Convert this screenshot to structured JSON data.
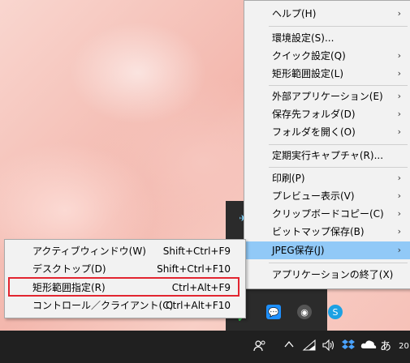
{
  "main_menu": {
    "items": [
      {
        "label": "ヘルプ(H)",
        "submenu": true
      },
      {
        "label": "環境設定(S)...",
        "submenu": false
      },
      {
        "label": "クイック設定(Q)",
        "submenu": true
      },
      {
        "label": "矩形範囲設定(L)",
        "submenu": true
      },
      {
        "label": "外部アプリケーション(E)",
        "submenu": true
      },
      {
        "label": "保存先フォルダ(D)",
        "submenu": true
      },
      {
        "label": "フォルダを開く(O)",
        "submenu": true
      },
      {
        "label": "定期実行キャプチャ(R)...",
        "submenu": false
      },
      {
        "label": "印刷(P)",
        "submenu": true
      },
      {
        "label": "プレビュー表示(V)",
        "submenu": true
      },
      {
        "label": "クリップボードコピー(C)",
        "submenu": true
      },
      {
        "label": "ビットマップ保存(B)",
        "submenu": true
      },
      {
        "label": "JPEG保存(J)",
        "submenu": true,
        "highlighted": true
      },
      {
        "label": "アプリケーションの終了(X)",
        "submenu": false
      }
    ],
    "arrow": "›"
  },
  "sub_menu": {
    "items": [
      {
        "label": "アクティブウィンドウ(W)",
        "shortcut": "Shift+Ctrl+F9"
      },
      {
        "label": "デスクトップ(D)",
        "shortcut": "Shift+Ctrl+F10"
      },
      {
        "label": "矩形範囲指定(R)",
        "shortcut": "Ctrl+Alt+F9"
      },
      {
        "label": "コントロール／クライアント(C)",
        "shortcut": "Ctrl+Alt+F10"
      }
    ]
  },
  "taskbar": {
    "ime": "あ",
    "clock": "20",
    "icons": [
      "people-icon",
      "chevron-up-icon",
      "network-icon",
      "volume-icon",
      "dropbox-icon",
      "onedrive-icon"
    ]
  },
  "colors": {
    "highlight": "#91c9f7",
    "annotation": "#e22530",
    "taskbar": "#202020"
  }
}
